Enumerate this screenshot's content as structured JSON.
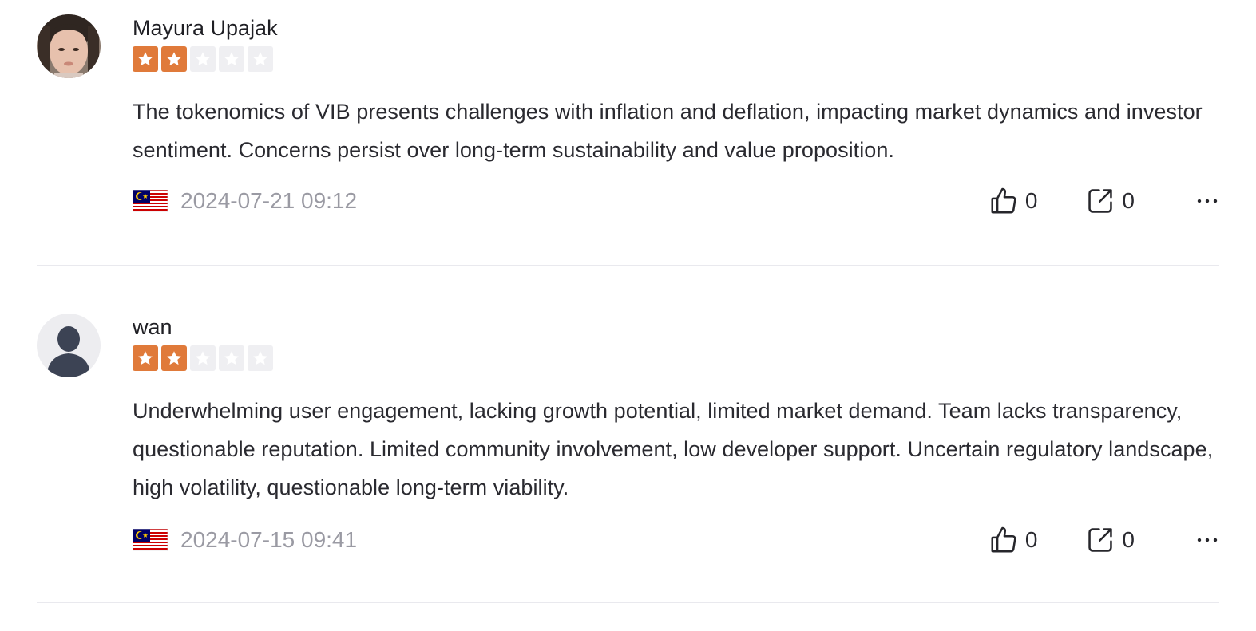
{
  "reviews": [
    {
      "username": "Mayura Upajak",
      "avatar": "user-photo-avatar",
      "rating": 2,
      "rating_max": 5,
      "text": "The tokenomics of VIB presents challenges with inflation and deflation, impacting market dynamics and investor sentiment. Concerns persist over long-term sustainability and value proposition.",
      "country_flag": "malaysia-flag-icon",
      "date": "2024-07-21 09:12",
      "likes": "0",
      "shares": "0"
    },
    {
      "username": "wan",
      "avatar": "default-user-avatar",
      "rating": 2,
      "rating_max": 5,
      "text": "Underwhelming user engagement, lacking growth potential, limited market demand. Team lacks transparency, questionable reputation. Limited community involvement, low developer support. Uncertain regulatory landscape, high volatility, questionable long-term viability.",
      "country_flag": "malaysia-flag-icon",
      "date": "2024-07-15 09:41",
      "likes": "0",
      "shares": "0"
    }
  ],
  "icons": {
    "like": "thumbs-up-icon",
    "share": "share-icon",
    "more": "more-horizontal-icon"
  },
  "colors": {
    "star_on": "#e07a3a",
    "star_off": "#efeff2",
    "date_text": "#9a9aa3",
    "divider": "#e9e9ee"
  }
}
